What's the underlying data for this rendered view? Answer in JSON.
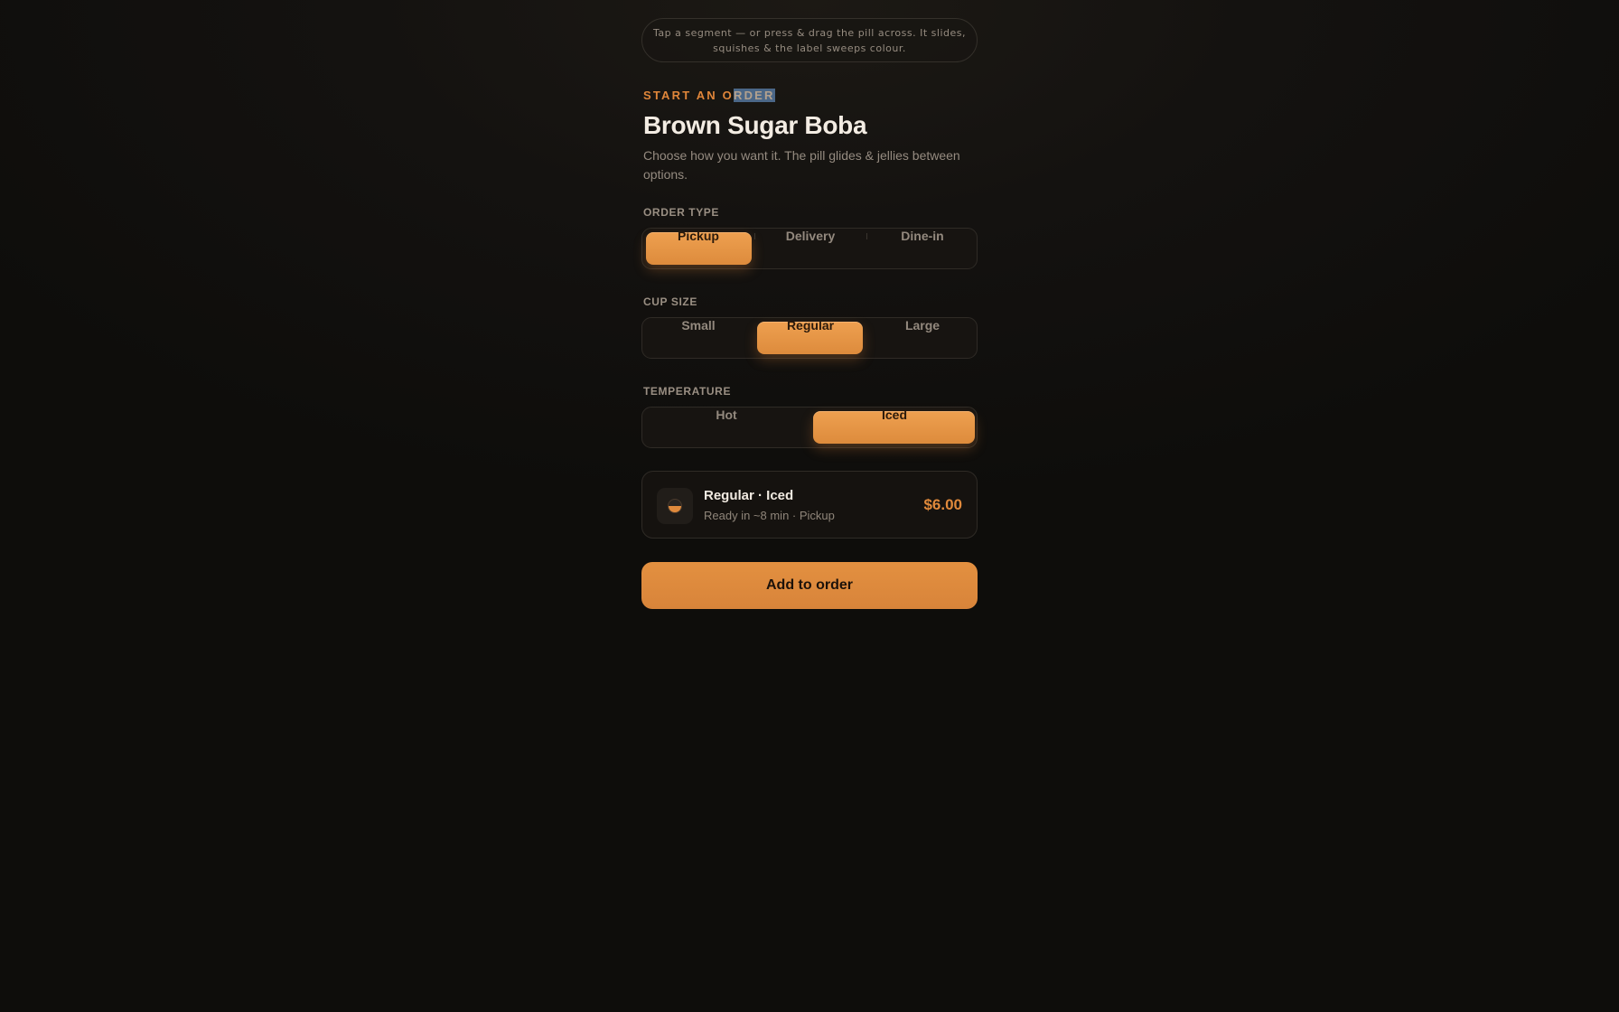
{
  "hint": {
    "line1": "Tap a segment — or press & drag the pill across. It slides,",
    "line2": "squishes & the label sweeps colour."
  },
  "header": {
    "eyebrow_a": "START AN O",
    "eyebrow_b": "RDER",
    "title": "Brown Sugar Boba",
    "description": "Choose how you want it. The pill glides & jellies between options."
  },
  "order_type": {
    "label": "ORDER TYPE",
    "options": [
      "Pickup",
      "Delivery",
      "Dine-in"
    ],
    "selected": "Pickup"
  },
  "cup_size": {
    "label": "CUP SIZE",
    "options": [
      "Small",
      "Regular",
      "Large"
    ],
    "selected": "Regular"
  },
  "temperature": {
    "label": "TEMPERATURE",
    "options": [
      "Hot",
      "Iced"
    ],
    "selected": "Iced"
  },
  "summary": {
    "icon": "cup-icon",
    "title": "Regular · Iced",
    "subtitle": "Ready in ~8 min · Pickup",
    "price": "$6.00"
  },
  "cta": {
    "label": "Add to order"
  },
  "colors": {
    "accent": "#e0863a",
    "background": "#0e0d0b",
    "text": "#f3ece3",
    "muted": "#958b80"
  }
}
